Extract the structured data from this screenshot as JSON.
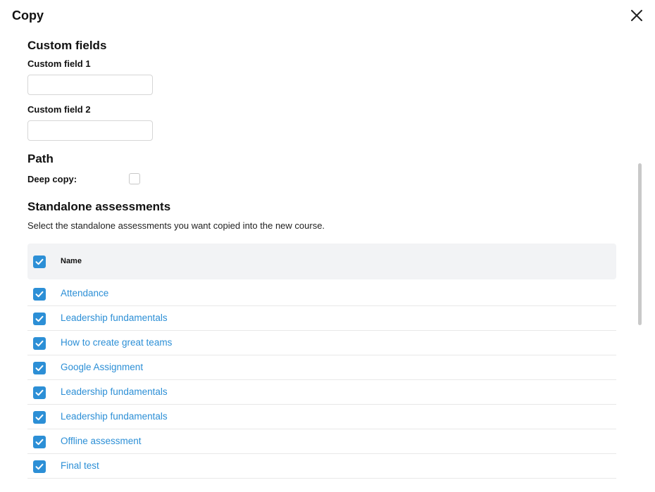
{
  "dialog": {
    "title": "Copy",
    "close_icon": "close-icon"
  },
  "custom_fields": {
    "title": "Custom fields",
    "field1_label": "Custom field 1",
    "field1_value": "",
    "field2_label": "Custom field 2",
    "field2_value": ""
  },
  "path": {
    "title": "Path",
    "deep_copy_label": "Deep copy:",
    "deep_copy_checked": false
  },
  "standalone": {
    "title": "Standalone assessments",
    "description": "Select the standalone assessments you want copied into the new course.",
    "header_name": "Name",
    "select_all_checked": true,
    "rows": [
      {
        "name": "Attendance",
        "checked": true
      },
      {
        "name": "Leadership fundamentals",
        "checked": true
      },
      {
        "name": "How to create great teams",
        "checked": true
      },
      {
        "name": "Google Assignment",
        "checked": true
      },
      {
        "name": "Leadership fundamentals",
        "checked": true
      },
      {
        "name": "Leadership fundamentals",
        "checked": true
      },
      {
        "name": "Offline assessment",
        "checked": true
      },
      {
        "name": "Final test",
        "checked": true
      }
    ]
  },
  "colors": {
    "accent": "#2c8fd6",
    "header_bg": "#f2f3f5"
  }
}
